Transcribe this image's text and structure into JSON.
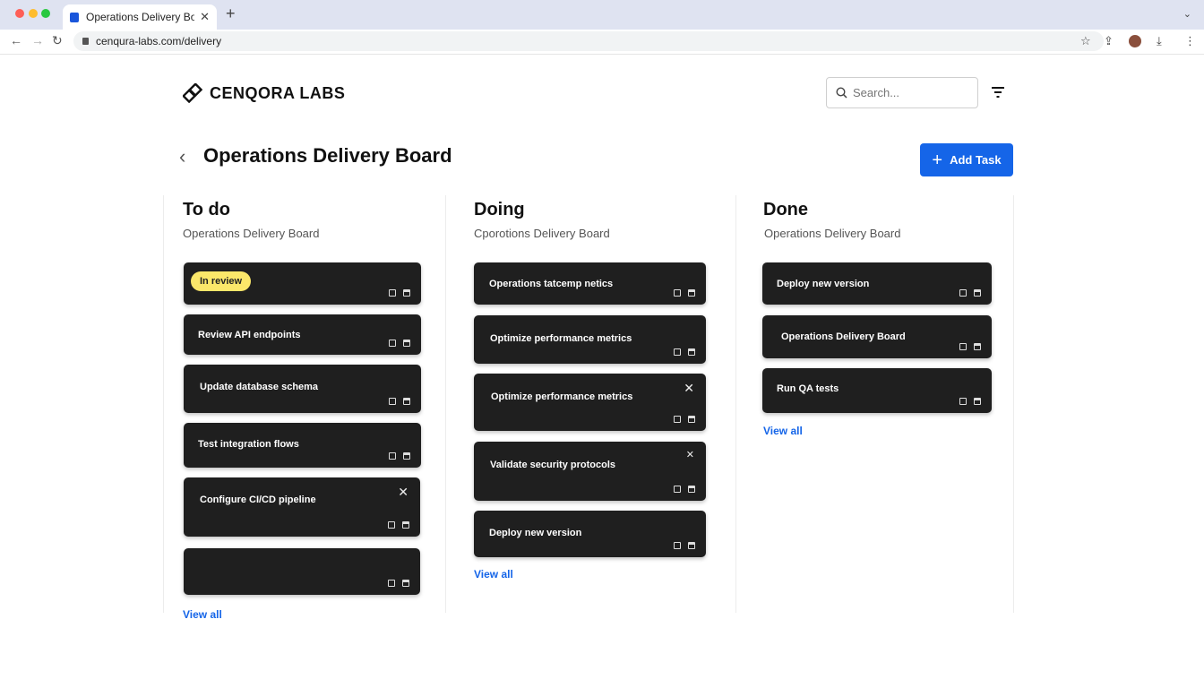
{
  "browser": {
    "tab_title": "Operations Delivery Boerd",
    "url": "cenqura-labs.com/delivery"
  },
  "brand": {
    "name": "CENQORA LABS"
  },
  "search": {
    "placeholder": "Search..."
  },
  "page": {
    "title": "Operations Delivery Board"
  },
  "actions": {
    "add_task_label": "Add Task"
  },
  "columns": [
    {
      "title": "To do",
      "subtitle": "Operations Delivery Board",
      "view_all": "View all",
      "cards": [
        {
          "title": "",
          "badge": "In review",
          "closable": false
        },
        {
          "title": "Review API endpoints",
          "closable": false
        },
        {
          "title": "Update database schema",
          "closable": false
        },
        {
          "title": "Test integration flows",
          "closable": false
        },
        {
          "title": "Configure CI/CD pipeline",
          "closable": true
        },
        {
          "title": "",
          "closable": false
        }
      ]
    },
    {
      "title": "Doing",
      "subtitle": "Cporotions Delivery Board",
      "view_all": "View all",
      "cards": [
        {
          "title": "Operations tatcemp netics",
          "closable": false
        },
        {
          "title": "Optimize performance metrics",
          "closable": false
        },
        {
          "title": "Optimize performance metrics",
          "closable": true
        },
        {
          "title": "Validate security protocols",
          "closable": true
        },
        {
          "title": "Deploy new version",
          "closable": false
        }
      ]
    },
    {
      "title": "Done",
      "subtitle": "Operations Delivery Board",
      "view_all": "View all",
      "cards": [
        {
          "title": "Deploy new version",
          "closable": false
        },
        {
          "title": "Operations Delivery Board",
          "closable": false
        },
        {
          "title": "Run QA tests",
          "closable": false
        }
      ]
    }
  ]
}
